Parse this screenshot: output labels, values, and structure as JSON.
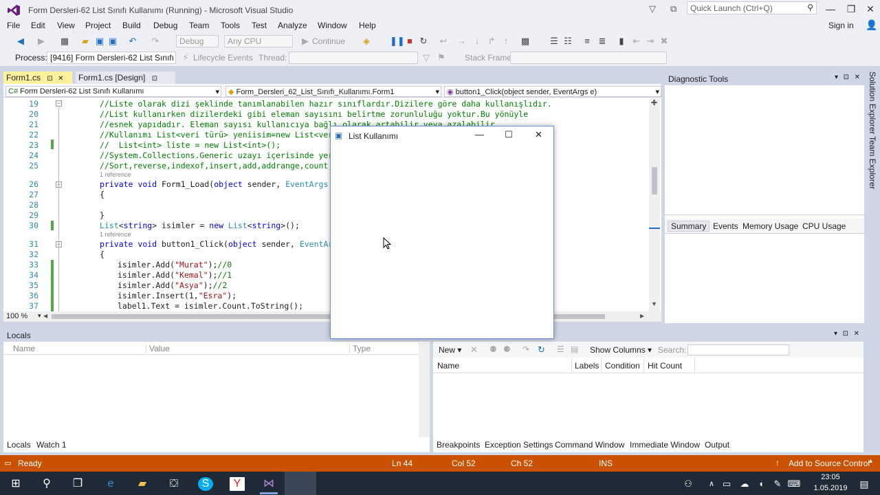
{
  "window": {
    "title": "Form Dersleri-62 List Sınıfı Kullanımı (Running) - Microsoft Visual Studio",
    "quick_launch_placeholder": "Quick Launch (Ctrl+Q)",
    "sign_in": "Sign in"
  },
  "menu": [
    "File",
    "Edit",
    "View",
    "Project",
    "Build",
    "Debug",
    "Team",
    "Tools",
    "Test",
    "Analyze",
    "Window",
    "Help"
  ],
  "toolbar": {
    "config": "Debug",
    "platform": "Any CPU",
    "continue": "Continue",
    "process_label": "Process:",
    "process_value": "[9416] Form Dersleri-62 List Sınıfı K",
    "lifecycle": "Lifecycle Events",
    "thread_label": "Thread:",
    "stack_label": "Stack Frame:"
  },
  "tabs": [
    "Form1.cs",
    "Form1.cs [Design]"
  ],
  "navbar": {
    "project": "Form Dersleri-62 List Sınıfı Kullanımı",
    "class": "Form_Dersleri_62_List_Sınıfı_Kullanımı.Form1",
    "member": "button1_Click(object sender, EventArgs e)"
  },
  "code": {
    "lines": [
      {
        "n": "19",
        "t": "//Liste olarak dizi şeklinde tanımlanabilen hazır sınıflardır.Dizilere göre daha kullanışlıdır."
      },
      {
        "n": "20",
        "t": "//List kullanırken dizilerdeki gibi eleman sayısını belirtme zorunluluğu yoktur.Bu yönüyle"
      },
      {
        "n": "21",
        "t": "//esnek yapıdadır. Eleman sayısı kullanıcıya bağlı olarak artabilir veya azalabilir."
      },
      {
        "n": "22",
        "t": "//Kullanımı List<veri türü> yeniisim=new List<veri"
      },
      {
        "n": "23",
        "t": "//  List<int> liste = new List<int>();"
      },
      {
        "n": "24",
        "t": "//System.Collections.Generic uzayı içerisinde yer a"
      },
      {
        "n": "25",
        "t": "//Sort,reverse,indexof,insert,add,addrange,count,re"
      },
      {
        "n": "26",
        "t": "private void Form1_Load(object sender, EventArgs e)"
      },
      {
        "n": "27",
        "t": "{"
      },
      {
        "n": "28",
        "t": ""
      },
      {
        "n": "29",
        "t": "}"
      },
      {
        "n": "30",
        "t": "List<string> isimler = new List<string>();"
      },
      {
        "n": "31",
        "t": "private void button1_Click(object sender, EventArgs"
      },
      {
        "n": "32",
        "t": "{"
      },
      {
        "n": "33",
        "t": "isimler.Add(\"Murat\");//0"
      },
      {
        "n": "34",
        "t": "isimler.Add(\"Kemal\");//1"
      },
      {
        "n": "35",
        "t": "isimler.Add(\"Asya\");//2"
      },
      {
        "n": "36",
        "t": "isimler.Insert(1,\"Esra\");"
      },
      {
        "n": "37",
        "t": "label1.Text = isimler.Count.ToString();"
      }
    ],
    "reference": "1 reference",
    "zoom": "100 %"
  },
  "dialog": {
    "title": "List Kullanımı"
  },
  "diagnostic": {
    "title": "Diagnostic Tools",
    "tabs": [
      "Summary",
      "Events",
      "Memory Usage",
      "CPU Usage"
    ]
  },
  "side_tabs": [
    "Solution Explorer",
    "Team Explorer"
  ],
  "locals": {
    "title": "Locals",
    "columns": [
      "Name",
      "Value",
      "Type"
    ],
    "tabs": [
      "Locals",
      "Watch 1"
    ]
  },
  "breakpoints": {
    "new_label": "New",
    "show_columns": "Show Columns",
    "search_label": "Search:",
    "columns": [
      "Name",
      "Labels",
      "Condition",
      "Hit Count"
    ],
    "tabs": [
      "Breakpoints",
      "Exception Settings",
      "Command Window",
      "Immediate Window",
      "Output"
    ]
  },
  "status": {
    "ready": "Ready",
    "ln": "Ln 44",
    "col": "Col 52",
    "ch": "Ch 52",
    "ins": "INS",
    "source_control": "Add to Source Control"
  },
  "taskbar": {
    "time": "23:05",
    "date": "1.05.2019"
  },
  "colors": {
    "status": "#ca5100",
    "active_tab": "#fff29d",
    "comment": "#008000",
    "keyword": "#0000ff"
  }
}
